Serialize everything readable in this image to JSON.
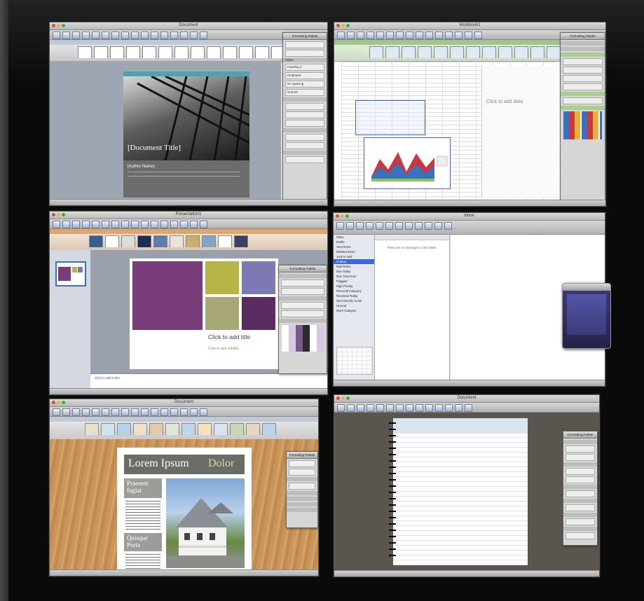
{
  "windows": {
    "word_cover": {
      "title": "Document",
      "doc_title": "[Document Title]",
      "author": "[Author Name]",
      "styles_palette": [
        "Heading 1",
        "Emphasis",
        "No Spacing",
        "Normal"
      ]
    },
    "excel": {
      "title": "Workbook1",
      "chart_placeholder": "Click to add data"
    },
    "powerpoint": {
      "title": "Presentation1",
      "click_to_add_title": "Click to add title",
      "click_to_add_subtitle": "Click to add subtitle",
      "notes_placeholder": "Click to add notes"
    },
    "entourage": {
      "title": "Inbox",
      "folders": [
        "Inbox",
        "Drafts",
        "Sent Items",
        "Deleted Items",
        "Junk E-mail",
        "Outbox",
        "Mail Rules",
        "Due Today",
        "Due Tomorrow",
        "Flagged",
        "High Priority",
        "Personal Category",
        "Received Today",
        "Sent Directly to Me",
        "Unread",
        "Work Category"
      ],
      "empty_message": "There are no messages in this folder."
    },
    "word_newsletter": {
      "title": "Document",
      "headline_1": "Lorem Ipsum",
      "headline_2": "Dolor",
      "side_heading_1": "Praesent",
      "side_heading_1b": "fugiat",
      "side_heading_2": "Quisque",
      "side_heading_2b": "Porta"
    },
    "notebook": {
      "title": "Document"
    }
  },
  "colors": {
    "background": "#0b0b0b",
    "stripe": "#3a3a3a",
    "ppt_purple": "#7a3d7c",
    "ppt_olive": "#b6b444",
    "ppt_lavender": "#7d79b4",
    "ppt_sage": "#a7a875",
    "ppt_plum": "#5a2c62",
    "news_wood": "#c9955a"
  }
}
